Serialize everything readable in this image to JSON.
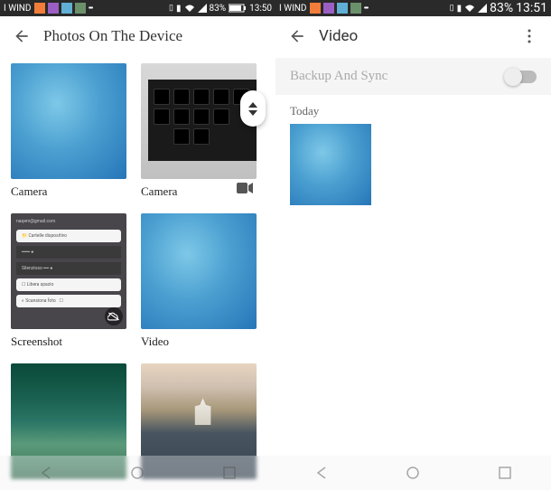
{
  "left": {
    "statusbar": {
      "carrier": "I WIND",
      "battery": "83%",
      "time": "13:50"
    },
    "title": "Photos On The Device",
    "albums": [
      {
        "name": "Camera",
        "kind": "blue"
      },
      {
        "name": "Camera",
        "kind": "keyboard"
      },
      {
        "name": "Screenshot",
        "kind": "screenshot"
      },
      {
        "name": "Video",
        "kind": "blue"
      },
      {
        "name": "",
        "kind": "forest"
      },
      {
        "name": "",
        "kind": "lake"
      }
    ]
  },
  "right": {
    "statusbar": {
      "carrier": "I WIND",
      "battery": "83%",
      "time": "13:51"
    },
    "title": "Video",
    "backup_label": "Backup And Sync",
    "backup_on": false,
    "section": "Today"
  }
}
